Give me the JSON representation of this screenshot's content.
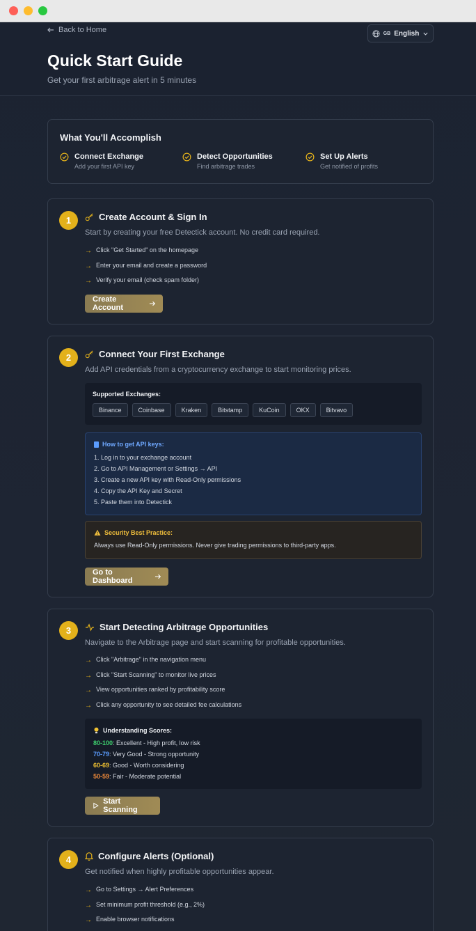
{
  "header": {
    "back_label": "Back to Home",
    "language": {
      "flag": "GB",
      "label": "English"
    },
    "title": "Quick Start Guide",
    "subtitle": "Get your first arbitrage alert in 5 minutes"
  },
  "accomplish": {
    "title": "What You'll Accomplish",
    "items": [
      {
        "title": "Connect Exchange",
        "subtitle": "Add your first API key"
      },
      {
        "title": "Detect Opportunities",
        "subtitle": "Find arbitrage trades"
      },
      {
        "title": "Set Up Alerts",
        "subtitle": "Get notified of profits"
      }
    ]
  },
  "steps": [
    {
      "number": "1",
      "icon": "key-icon",
      "title": "Create Account & Sign In",
      "description": "Start by creating your free Detectick account. No credit card required.",
      "items": [
        "Click \"Get Started\" on the homepage",
        "Enter your email and create a password",
        "Verify your email (check spam folder)"
      ],
      "button": "Create Account"
    },
    {
      "number": "2",
      "icon": "key-icon",
      "title": "Connect Your First Exchange",
      "description": "Add API credentials from a cryptocurrency exchange to start monitoring prices.",
      "exchanges_label": "Supported Exchanges:",
      "exchanges": [
        "Binance",
        "Coinbase",
        "Kraken",
        "Bitstamp",
        "KuCoin",
        "OKX",
        "Bitvavo"
      ],
      "api_label": "How to get API keys:",
      "api_steps": [
        "1. Log in to your exchange account",
        "2. Go to API Management or Settings → API",
        "3. Create a new API key with Read-Only permissions",
        "4. Copy the API Key and Secret",
        "5. Paste them into Detectick"
      ],
      "security_label": "Security Best Practice:",
      "security_text": "Always use Read-Only permissions. Never give trading permissions to third-party apps.",
      "button": "Go to Dashboard"
    },
    {
      "number": "3",
      "icon": "activity-icon",
      "title": "Start Detecting Arbitrage Opportunities",
      "description": "Navigate to the Arbitrage page and start scanning for profitable opportunities.",
      "items": [
        "Click \"Arbitrage\" in the navigation menu",
        "Click \"Start Scanning\" to monitor live prices",
        "View opportunities ranked by profitability score",
        "Click any opportunity to see detailed fee calculations"
      ],
      "scores_label": "Understanding Scores:",
      "scores": [
        {
          "range": "80-100",
          "text": ": Excellent - High profit, low risk",
          "color": "#3ecf6e"
        },
        {
          "range": "70-79",
          "text": ": Very Good - Strong opportunity",
          "color": "#5b9cff"
        },
        {
          "range": "60-69",
          "text": ": Good - Worth considering",
          "color": "#f1c232"
        },
        {
          "range": "50-59",
          "text": ": Fair - Moderate potential",
          "color": "#f08a3a"
        }
      ],
      "button": "Start Scanning"
    },
    {
      "number": "4",
      "icon": "bell-icon",
      "title": "Configure Alerts (Optional)",
      "description": "Get notified when highly profitable opportunities appear.",
      "items": [
        "Go to Settings → Alert Preferences",
        "Set minimum profit threshold (e.g., 2%)",
        "Enable browser notifications"
      ]
    }
  ],
  "colors": {
    "accent": "#e3b11b",
    "background": "#1b2230"
  }
}
